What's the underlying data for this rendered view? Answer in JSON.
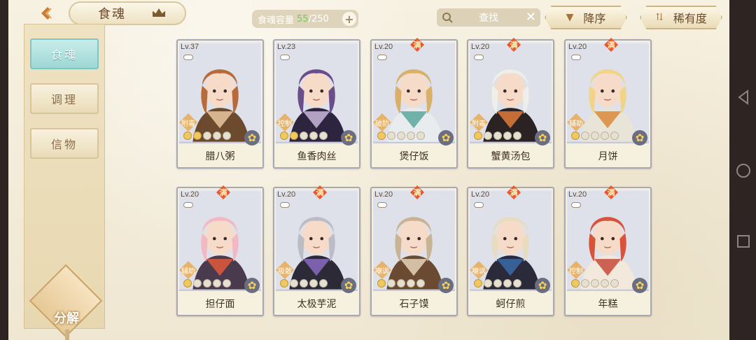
{
  "header": {
    "title": "食魂",
    "capacity_label": "食魂容量",
    "capacity_current": "55",
    "capacity_sep": "/",
    "capacity_max": "250",
    "plus": "+",
    "search_label": "查找",
    "clear": "✕",
    "sort_desc": "降序",
    "sort_rarity": "稀有度"
  },
  "sidebar": {
    "items": [
      {
        "label": "食魂",
        "active": true
      },
      {
        "label": "调理",
        "active": false
      },
      {
        "label": "信物",
        "active": false
      }
    ],
    "decompose": "分解"
  },
  "cards": [
    {
      "lv": "Lv.37",
      "full": "",
      "role": "附毒",
      "name": "腊八粥",
      "stars": 2,
      "colors": [
        "#b86b3a",
        "#6b4a2e",
        "#e8c7a0"
      ]
    },
    {
      "lv": "Lv.23",
      "full": "",
      "role": "控制",
      "name": "鱼香肉丝",
      "stars": 2,
      "colors": [
        "#6a4e8c",
        "#2d2540",
        "#c9b9dc"
      ]
    },
    {
      "lv": "Lv.20",
      "full": "满",
      "role": "破防",
      "name": "煲仔饭",
      "stars": 1,
      "colors": [
        "#d8b06a",
        "#e9ecef",
        "#5aa89e"
      ]
    },
    {
      "lv": "Lv.20",
      "full": "满",
      "role": "附毒",
      "name": "蟹黄汤包",
      "stars": 1,
      "colors": [
        "#f0eee8",
        "#2b2323",
        "#e07a3a"
      ]
    },
    {
      "lv": "Lv.20",
      "full": "满",
      "role": "辅助",
      "name": "月饼",
      "stars": 1,
      "colors": [
        "#f2d488",
        "#e8e4d8",
        "#d98a3a"
      ]
    },
    {
      "lv": "Lv.20",
      "full": "满",
      "role": "辅助",
      "name": "担仔面",
      "stars": 1,
      "colors": [
        "#f2b9c4",
        "#4a3a4e",
        "#e25a3a"
      ]
    },
    {
      "lv": "Lv.20",
      "full": "满",
      "role": "吸散",
      "name": "太极芋泥",
      "stars": 1,
      "colors": [
        "#bcbcc8",
        "#2c2a36",
        "#8a6ac0"
      ]
    },
    {
      "lv": "Lv.20",
      "full": "满",
      "role": "嘲讽",
      "name": "石子馍",
      "stars": 1,
      "colors": [
        "#c8b494",
        "#6b4a32",
        "#e8d4b8"
      ]
    },
    {
      "lv": "Lv.20",
      "full": "满",
      "role": "嘲讽",
      "name": "蚵仔煎",
      "stars": 1,
      "colors": [
        "#e8dcc0",
        "#2b2a3a",
        "#3a6aa8"
      ]
    },
    {
      "lv": "Lv.20",
      "full": "满",
      "role": "控制",
      "name": "年糕",
      "stars": 1,
      "colors": [
        "#d8533a",
        "#f2e8dc",
        "#c84a3a"
      ]
    }
  ]
}
